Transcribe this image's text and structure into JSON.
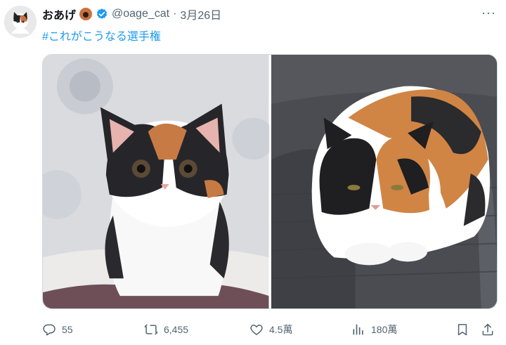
{
  "post": {
    "author_name": "おあげ",
    "handle": "@oage_cat",
    "separator": "·",
    "date": "3月26日",
    "text": "#これがこうなる選手権",
    "more_label": "···"
  },
  "stats": {
    "replies": "55",
    "reposts": "6,455",
    "likes": "4.5萬",
    "views": "180萬"
  },
  "colors": {
    "link": "#1d9bf0",
    "verified": "#1d9bf0",
    "muted": "#536471"
  },
  "icons": [
    "reply-icon",
    "repost-icon",
    "like-icon",
    "views-icon",
    "bookmark-icon",
    "share-icon",
    "verified-badge-icon",
    "more-icon"
  ]
}
